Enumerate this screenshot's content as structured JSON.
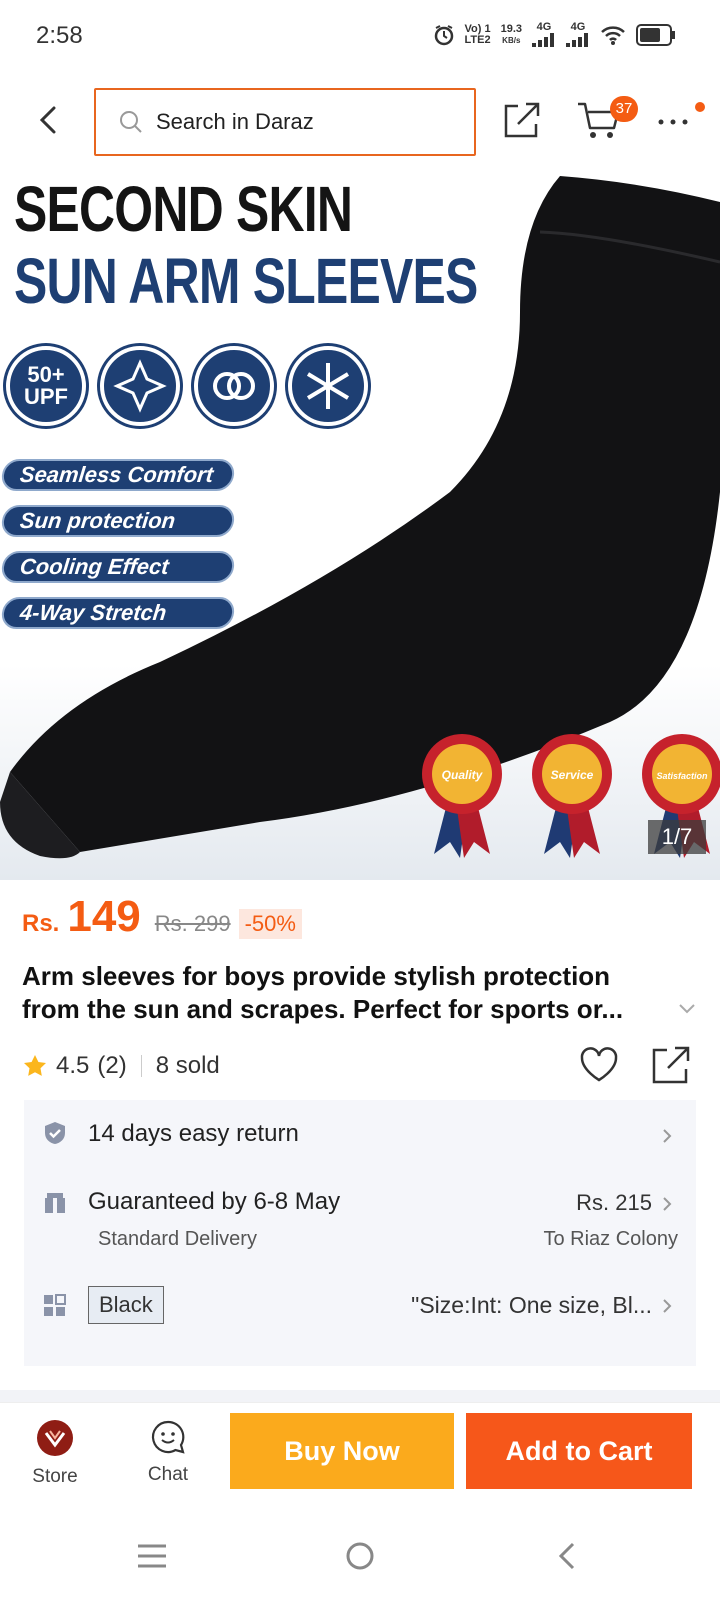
{
  "status_bar": {
    "time": "2:58",
    "volte": "Vo) 1",
    "lte": "LTE2",
    "speed_value": "19.3",
    "speed_unit": "KB/s",
    "net1": "4G",
    "net2": "4G"
  },
  "header": {
    "search_placeholder": "Search in Daraz",
    "cart_count": "37"
  },
  "product_image": {
    "title_line1": "SECOND SKIN",
    "title_line2": "SUN ARM SLEEVES",
    "badge_upf_line1": "50+",
    "badge_upf_line2": "UPF",
    "features": [
      "Seamless Comfort",
      "Sun protection",
      "Cooling Effect",
      "4-Way Stretch"
    ],
    "awards": [
      "Quality",
      "Service",
      "Satisfaction"
    ],
    "counter": "1/7"
  },
  "price": {
    "currency": "Rs.",
    "current": "149",
    "original": "Rs. 299",
    "discount": "-50%"
  },
  "product": {
    "title": "Arm sleeves for boys provide stylish protection from the sun and scrapes. Perfect for sports or...",
    "rating": "4.5",
    "reviews": "(2)",
    "sold": "8 sold"
  },
  "info": {
    "return_text": "14 days easy return",
    "delivery_text": "Guaranteed by 6-8 May",
    "delivery_type": "Standard Delivery",
    "delivery_price": "Rs. 215",
    "delivery_location": "To Riaz Colony",
    "variant_color": "Black",
    "variant_spec": "\"Size:Int: One size, Bl..."
  },
  "actions": {
    "store_label": "Store",
    "chat_label": "Chat",
    "buy_now_label": "Buy Now",
    "add_to_cart_label": "Add to Cart"
  },
  "colors": {
    "accent_orange": "#f45c13",
    "buy_now": "#fbaa1c",
    "add_to_cart": "#f6571a",
    "image_navy": "#1e3f73"
  }
}
